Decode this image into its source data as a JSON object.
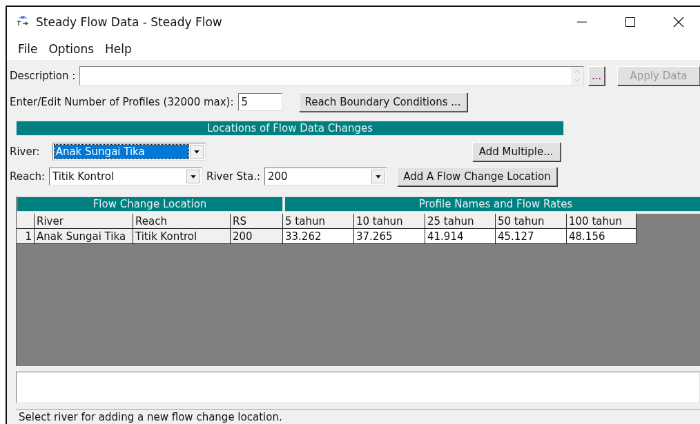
{
  "window": {
    "title": "Steady Flow Data - Steady Flow"
  },
  "menu": [
    "File",
    "Options",
    "Help"
  ],
  "description": {
    "label": "Description :",
    "more_button": "...",
    "apply_button": {
      "label": "Apply Data",
      "disabled": true
    }
  },
  "profiles": {
    "label": "Enter/Edit Number of Profiles (32000 max):",
    "value": "5",
    "button": "Reach Boundary Conditions ..."
  },
  "locations": {
    "header": "Locations of Flow Data Changes",
    "river": {
      "label": "River:",
      "value": "Anak Sungai Tika",
      "selected": true
    },
    "add_multiple": "Add Multiple...",
    "reach": {
      "label": "Reach:",
      "value": "Titik Kontrol",
      "selected": false
    },
    "river_sta": {
      "label": "River Sta.:",
      "value": "200",
      "selected": false
    },
    "add_location": "Add A Flow Change Location"
  },
  "table": {
    "group_headers": [
      "Flow Change Location",
      "Profile Names and Flow Rates"
    ],
    "columns": [
      "River",
      "Reach",
      "RS",
      "5 tahun",
      "10 tahun",
      "25 tahun",
      "50 tahun",
      "100 tahun"
    ],
    "rows": [
      {
        "number": "1",
        "cells": [
          "Anak Sungai Tika",
          "Titik Kontrol",
          "200",
          "33.262",
          "37.265",
          "41.914",
          "45.127",
          "48.156"
        ]
      }
    ]
  },
  "status_bar": "Select river for adding a new flow change location."
}
